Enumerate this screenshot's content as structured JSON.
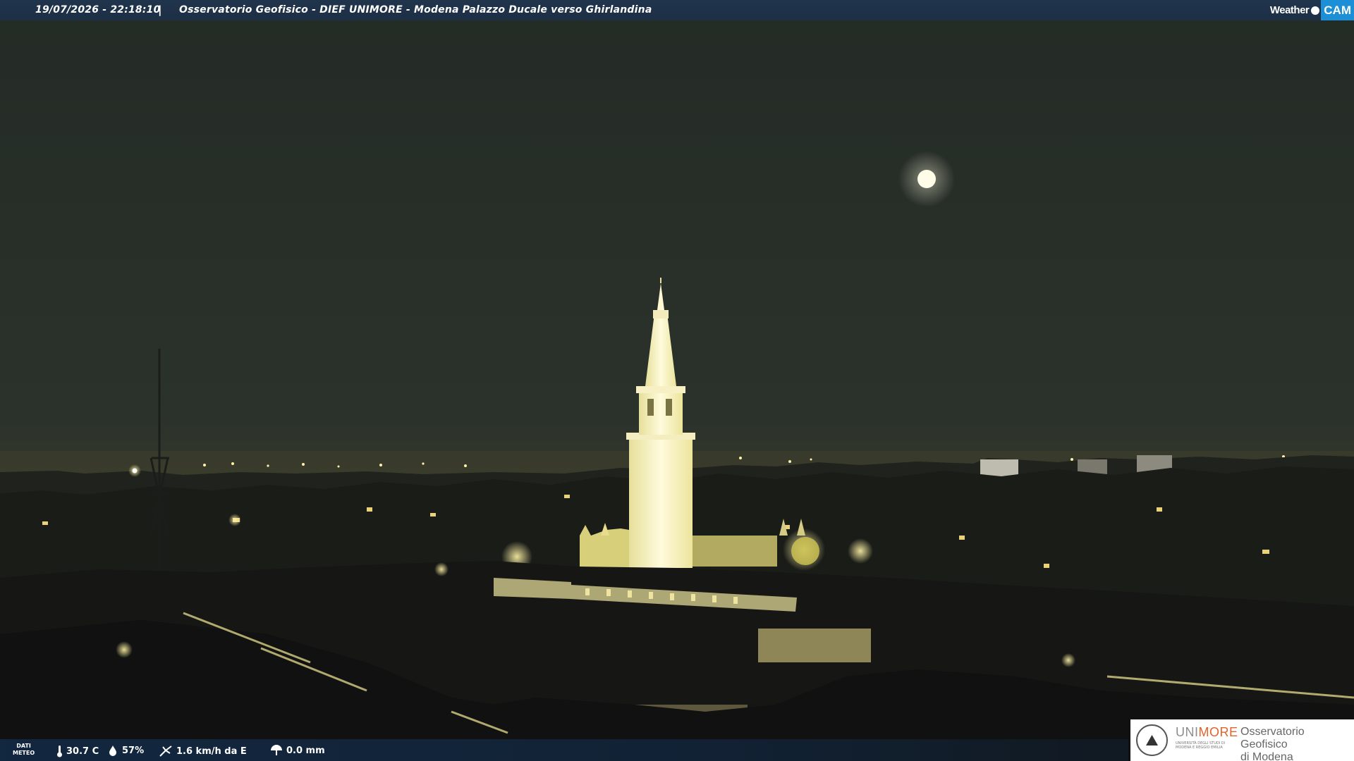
{
  "topbar": {
    "timestamp": "19/07/2026 - 22:18:10",
    "separator": "|",
    "title": "Osservatorio Geofisico - DIEF UNIMORE - Modena Palazzo Ducale verso Ghirlandina",
    "brand_weather": "Weather",
    "brand_cam": "CAM"
  },
  "bottombar": {
    "dati_label_1": "DATI",
    "dati_label_2": "METEO",
    "temperature": "30.7 C",
    "humidity": "57%",
    "wind": "1.6 km/h da E",
    "rain": "0.0 mm",
    "icons": [
      "thermometer-icon",
      "humidity-drop-icon",
      "wind-icon",
      "rain-gauge-icon"
    ]
  },
  "logo": {
    "uni_a": "UNI",
    "uni_b": "MORE",
    "uni_small_1": "UNIVERSITÀ DEGLI STUDI DI",
    "uni_small_2": "MODENA E REGGIO EMILIA",
    "obs_1": "Osservatorio Geofisico",
    "obs_2": "di Modena"
  },
  "colors": {
    "bar": "#1c2f45",
    "brand_accent": "#1c8fd6",
    "unimore_orange": "#e2632b",
    "sky": "#2a302a",
    "tower_light": "#fff6c8"
  }
}
